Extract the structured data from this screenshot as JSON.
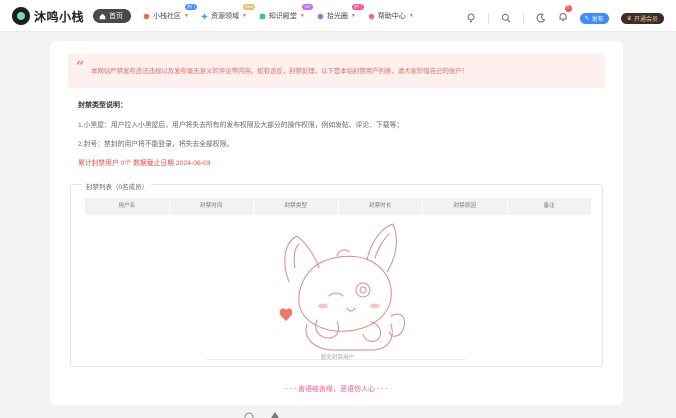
{
  "header": {
    "logo_text": "沐鸣小栈",
    "nav": [
      {
        "label": "首页",
        "icon": "home-icon",
        "active": true,
        "badge": "",
        "dropdown": false
      },
      {
        "label": "小栈社区",
        "icon": "community-icon",
        "badge": "热门",
        "badge_color": "#3d8bff",
        "dropdown": true
      },
      {
        "label": "资源领域",
        "icon": "resource-icon",
        "badge": "New",
        "badge_color": "#e8c06a",
        "dropdown": true
      },
      {
        "label": "知识殿堂",
        "icon": "knowledge-icon",
        "badge": "VIP",
        "badge_color": "#c86bf0",
        "dropdown": true
      },
      {
        "label": "拾光圈",
        "icon": "moments-icon",
        "badge": "热门",
        "badge_color": "#f4508a",
        "dropdown": true
      },
      {
        "label": "帮助中心",
        "icon": "help-icon",
        "badge": "",
        "dropdown": true
      }
    ],
    "notification_count": "0",
    "publish_label": "发布",
    "vip_label": "开通会员"
  },
  "notice": {
    "text": "本网站严禁发布违法违规以及发布毫无意义的评论等内容。如有违反，封禁处理。以下是本站封禁用户列表，请大家珍惜自己的账户！"
  },
  "ban_info": {
    "title": "封禁类型说明：",
    "items": [
      "1.小黑屋：用户拉入小黑屋后，用户将失去所有的发布权限及大部分的操作权限，例如发帖、评论、下载等；",
      "2.封号：禁封的用户将不能登录，将失去全部权限。"
    ],
    "stat": "累计封禁用户 0个 数据截止日期 2024-06-03"
  },
  "ban_list": {
    "legend": "封禁列表（0名成员）",
    "columns": [
      "用户名",
      "封禁时间",
      "封禁类型",
      "封禁时长",
      "封禁原因",
      "备注"
    ],
    "rows": [],
    "empty_text": "暂无封禁用户"
  },
  "footer": {
    "motto": "- - - 善语结善缘，恶语伤人心 - - -"
  },
  "colors": {
    "accent_red": "#e56c65",
    "notice_bg": "#fdf0ef",
    "motto_pink": "#ec5a96",
    "publish_blue": "#3d8bff"
  }
}
